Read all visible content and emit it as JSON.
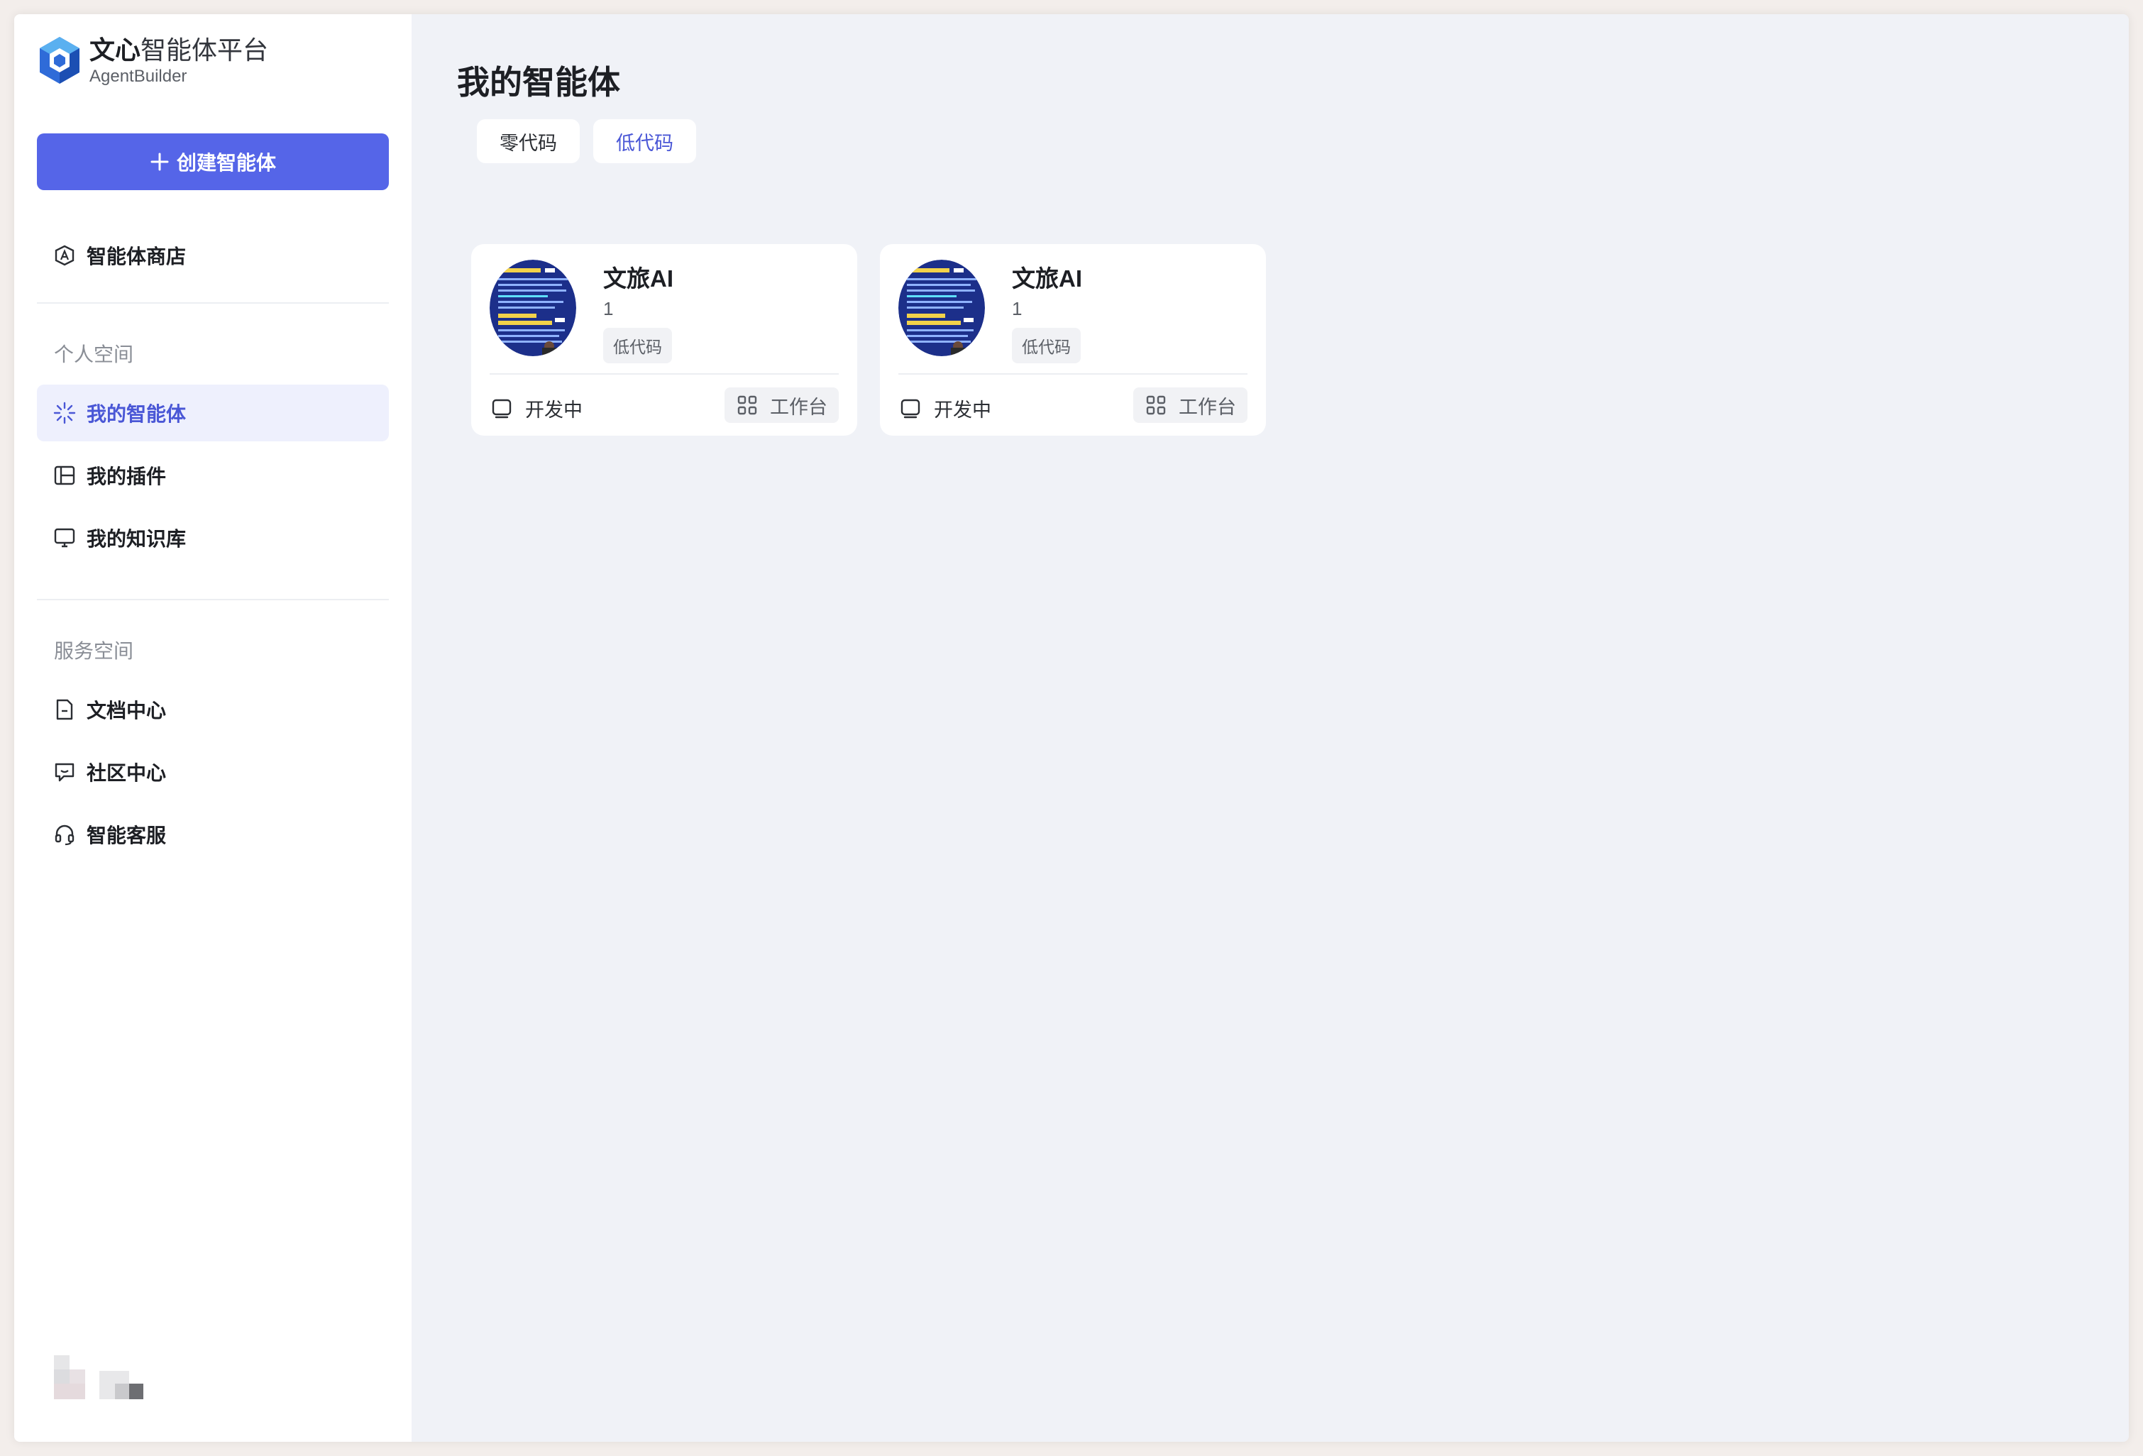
{
  "brand": {
    "name_bold": "文心",
    "name_light": "智能体平台",
    "sub": "AgentBuilder"
  },
  "sidebar": {
    "create_label": "创建智能体",
    "store_label": "智能体商店",
    "personal_section": "个人空间",
    "personal_items": [
      {
        "label": "我的智能体",
        "icon": "sparkle-icon",
        "active": true
      },
      {
        "label": "我的插件",
        "icon": "plugin-icon",
        "active": false
      },
      {
        "label": "我的知识库",
        "icon": "monitor-icon",
        "active": false
      }
    ],
    "service_section": "服务空间",
    "service_items": [
      {
        "label": "文档中心",
        "icon": "document-icon"
      },
      {
        "label": "社区中心",
        "icon": "chat-icon"
      },
      {
        "label": "智能客服",
        "icon": "headset-icon"
      }
    ]
  },
  "main": {
    "title": "我的智能体",
    "tabs": [
      {
        "label": "零代码",
        "active": false
      },
      {
        "label": "低代码",
        "active": true
      }
    ],
    "agents": [
      {
        "name": "文旅AI",
        "desc": "1",
        "tag": "低代码",
        "status": "开发中",
        "action": "工作台"
      },
      {
        "name": "文旅AI",
        "desc": "1",
        "tag": "低代码",
        "status": "开发中",
        "action": "工作台"
      }
    ]
  },
  "colors": {
    "accent": "#5565e8",
    "active_bg": "#eef0fd",
    "main_bg": "#f0f2f7"
  }
}
